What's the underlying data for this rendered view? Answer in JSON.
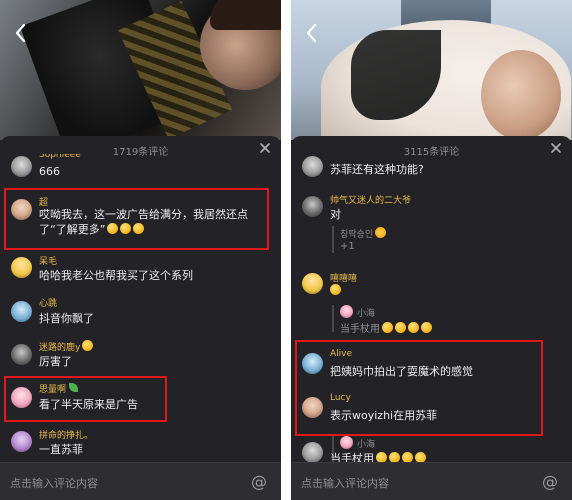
{
  "left": {
    "count": "1719条评论",
    "partial_top_name": "Sophieee",
    "partial_top_text": "666",
    "comments": [
      {
        "name": "超",
        "text": "哎呦我去，这一波广告给满分，我居然还点了“了解更多”",
        "emoji_count": 3
      },
      {
        "name": "呆毛",
        "text": "哈哈我老公也帮我买了这个系列"
      },
      {
        "name": "心跳",
        "text": "抖音你飘了"
      },
      {
        "name": "迷路的鹿y",
        "text": "厉害了"
      },
      {
        "name": "思量啊",
        "text": "看了半天原来是广告"
      },
      {
        "name": "拼命的挣扎。",
        "text": "一直苏菲"
      }
    ],
    "input_placeholder": "点击输入评论内容",
    "at_symbol": "@"
  },
  "right": {
    "count": "3115条评论",
    "comments": [
      {
        "name": "",
        "text": "苏菲还有这种功能?"
      },
      {
        "name": "帅气又迷人的二大爷",
        "text": "对"
      },
      {
        "name": "",
        "text": "",
        "reply_name": "칭딱승인",
        "reply_text": "+1"
      },
      {
        "name": "嘻嘻嘻",
        "text": ""
      },
      {
        "name": "",
        "text": "",
        "reply_name": "小海",
        "reply_text": "当手杖用"
      },
      {
        "name": "Alive",
        "text": "把姨妈巾拍出了耍魔术的感觉"
      },
      {
        "name": "Lucy",
        "text": "表示woyizhi在用苏菲"
      },
      {
        "name": "",
        "text": "",
        "reply_name": "小海",
        "reply_text": "当手杖用"
      }
    ],
    "input_placeholder": "点击输入评论内容",
    "at_symbol": "@"
  },
  "colors": {
    "highlight": "#e0181c",
    "username": "#e9b94b",
    "sheet_bg": "#232327"
  },
  "icons": [
    "back-chevron-icon",
    "close-icon",
    "at-icon",
    "emoji-icon",
    "leaf-icon"
  ]
}
